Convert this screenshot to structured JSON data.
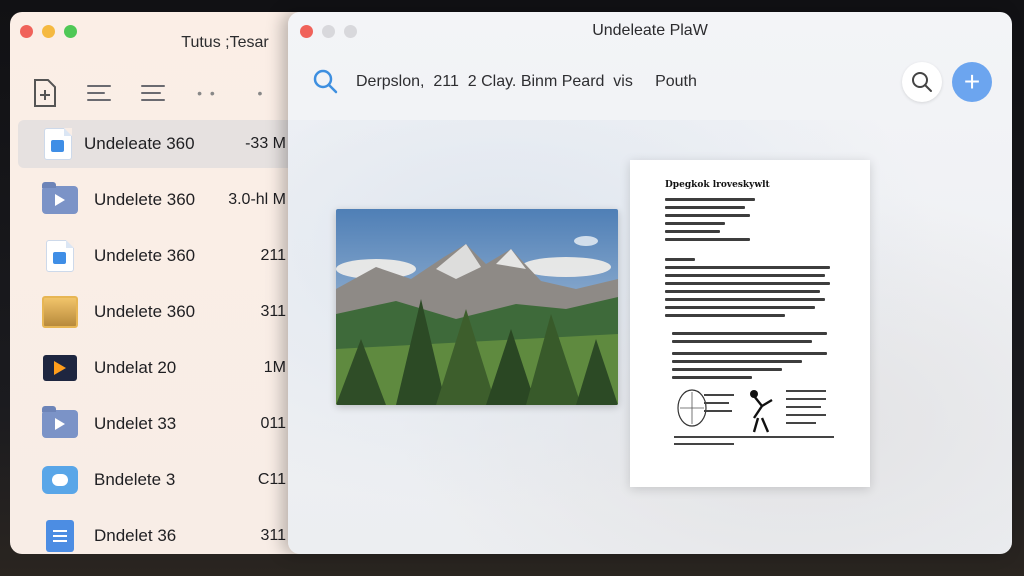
{
  "left_window": {
    "title": "Tutus ;Tesar",
    "toolbar_more": "• •",
    "toolbar_dot": "•"
  },
  "files": [
    {
      "name": "Undeleate 360",
      "size": "-33 M",
      "icon": "doc-icon",
      "selected": true
    },
    {
      "name": "Undelete 360",
      "size": "3.0-hl M",
      "icon": "video-folder-icon"
    },
    {
      "name": "Undelete 360",
      "size": "211",
      "icon": "doc-icon"
    },
    {
      "name": "Undelete 360",
      "size": "311",
      "icon": "image-icon"
    },
    {
      "name": "Undelat 20",
      "size": "1M",
      "icon": "media-icon"
    },
    {
      "name": "Undelet 33",
      "size": "011",
      "icon": "video-folder-icon"
    },
    {
      "name": "Bndelete 3",
      "size": "C11",
      "icon": "cloud-icon"
    },
    {
      "name": "Dndelet 36",
      "size": "311",
      "icon": "note-icon"
    }
  ],
  "main_window": {
    "title": "Undeleate PlaW",
    "breadcrumb": "Derpslon,  211  2 Clay. Binm Peard  vis     Pouth",
    "add_label": "+"
  },
  "document": {
    "title": "Dpegkok  lroveskywlt"
  },
  "colors": {
    "accent": "#6ca5ef",
    "close": "#f0625a",
    "minimize": "#f5b941",
    "zoom": "#4fc856"
  }
}
